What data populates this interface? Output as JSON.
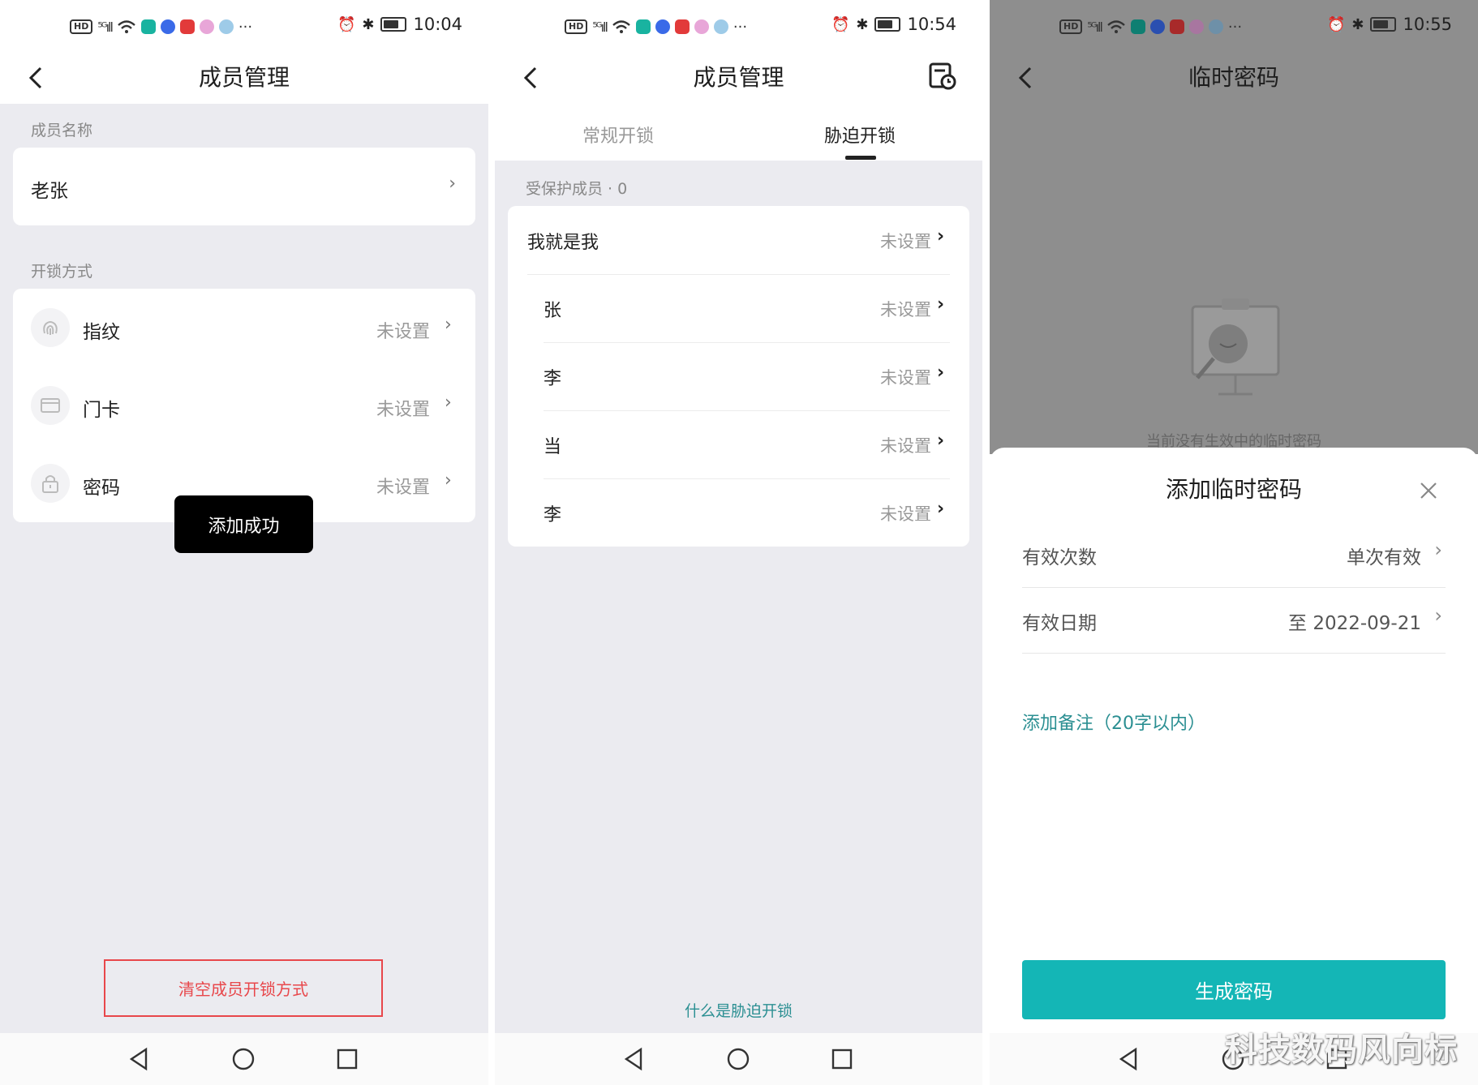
{
  "screen1": {
    "status_time": "10:04",
    "title": "成员管理",
    "member_name_label": "成员名称",
    "member_name": "老张",
    "unlock_methods_label": "开锁方式",
    "methods": [
      {
        "label": "指纹",
        "value": "未设置",
        "icon": "fingerprint-icon"
      },
      {
        "label": "门卡",
        "value": "未设置",
        "icon": "card-icon"
      },
      {
        "label": "密码",
        "value": "未设置",
        "icon": "lock-icon"
      }
    ],
    "toast": "添加成功",
    "clear_button": "清空成员开锁方式"
  },
  "screen2": {
    "status_time": "10:54",
    "title": "成员管理",
    "tabs": [
      "常规开锁",
      "胁迫开锁"
    ],
    "active_tab": "胁迫开锁",
    "protected_label": "受保护成员 · 0",
    "members": [
      {
        "name": "我就是我",
        "value": "未设置"
      },
      {
        "name": "张",
        "value": "未设置"
      },
      {
        "name": "李",
        "value": "未设置"
      },
      {
        "name": "当",
        "value": "未设置"
      },
      {
        "name": "李",
        "value": "未设置"
      }
    ],
    "help_link": "什么是胁迫开锁"
  },
  "screen3": {
    "status_time": "10:55",
    "title": "临时密码",
    "empty_text": "当前没有生效中的临时密码",
    "sheet_title": "添加临时密码",
    "fields": [
      {
        "label": "有效次数",
        "value": "单次有效"
      },
      {
        "label": "有效日期",
        "value": "至 2022-09-21"
      }
    ],
    "add_note": "添加备注（20字以内）",
    "generate_button": "生成密码"
  },
  "watermark": "科技数码风向标",
  "colors": {
    "accent": "#14b6b6",
    "link": "#2b8f92",
    "danger": "#e8474b",
    "page_bg": "#ebebf0"
  }
}
